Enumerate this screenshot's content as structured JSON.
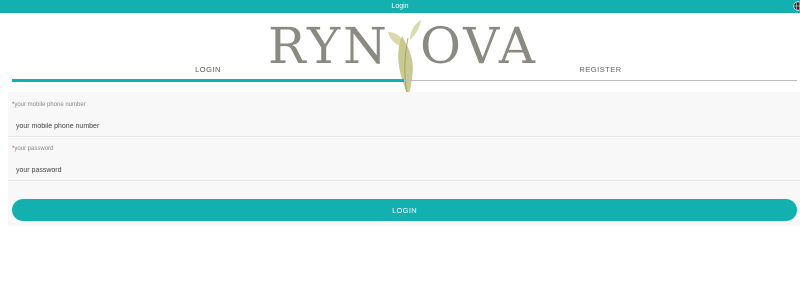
{
  "header": {
    "title": "Login",
    "globe_icon": "globe-icon"
  },
  "logo": {
    "left": "RYN",
    "right": "OVA"
  },
  "tabs": [
    {
      "label": "LOGIN",
      "active": true
    },
    {
      "label": "REGISTER",
      "active": false
    }
  ],
  "form": {
    "phone": {
      "required_mark": "*",
      "label": "your mobile phone number",
      "placeholder": "your mobile phone number",
      "value": ""
    },
    "password": {
      "required_mark": "*",
      "label": "your password",
      "placeholder": "your password",
      "value": ""
    }
  },
  "submit_label": "LOGIN",
  "colors": {
    "accent": "#12b0af",
    "required": "#e03a3a",
    "logo_text": "#8a8a80",
    "logo_leaf": "#b5b86e"
  }
}
